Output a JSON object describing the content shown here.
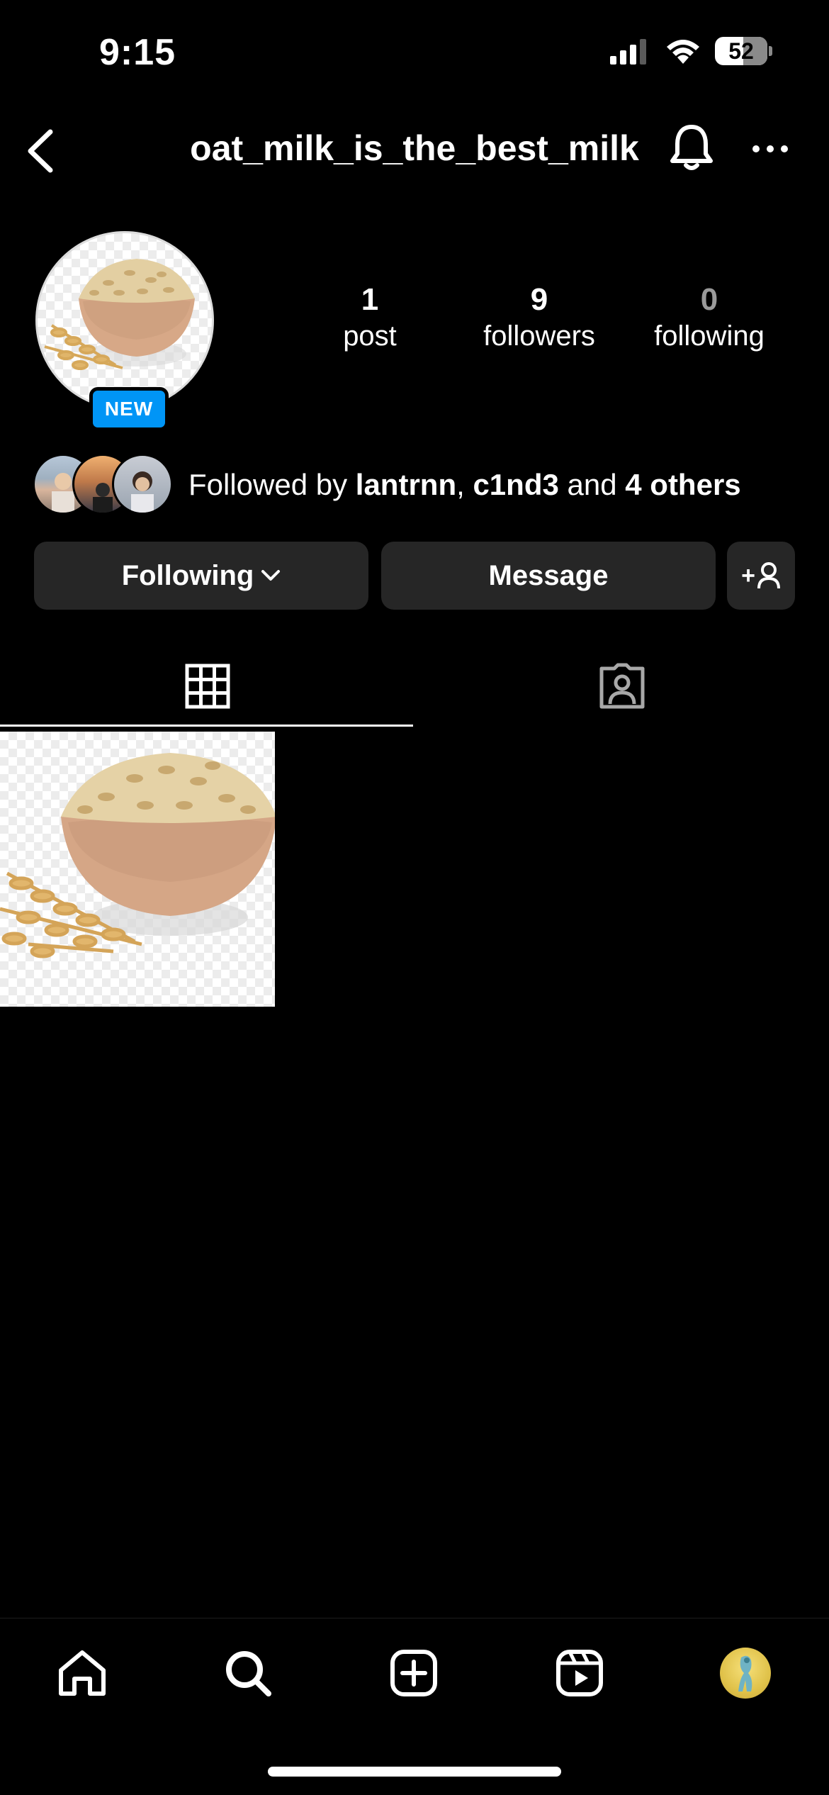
{
  "status_bar": {
    "time": "9:15",
    "battery": "52"
  },
  "header": {
    "username": "oat_milk_is_the_best_milk"
  },
  "profile": {
    "badge": "NEW",
    "stats": [
      {
        "value": "1",
        "label": "post"
      },
      {
        "value": "9",
        "label": "followers"
      },
      {
        "value": "0",
        "label": "following"
      }
    ],
    "followed_by": {
      "prefix": "Followed by ",
      "user1": "lantrnn",
      "sep": ", ",
      "user2": "c1nd3",
      "and": " and ",
      "others": "4 others"
    }
  },
  "actions": {
    "following_label": "Following",
    "message_label": "Message",
    "add_user_label": "+"
  },
  "colors": {
    "badge": "#0095f6",
    "button_bg": "#262626",
    "background": "#000000"
  }
}
